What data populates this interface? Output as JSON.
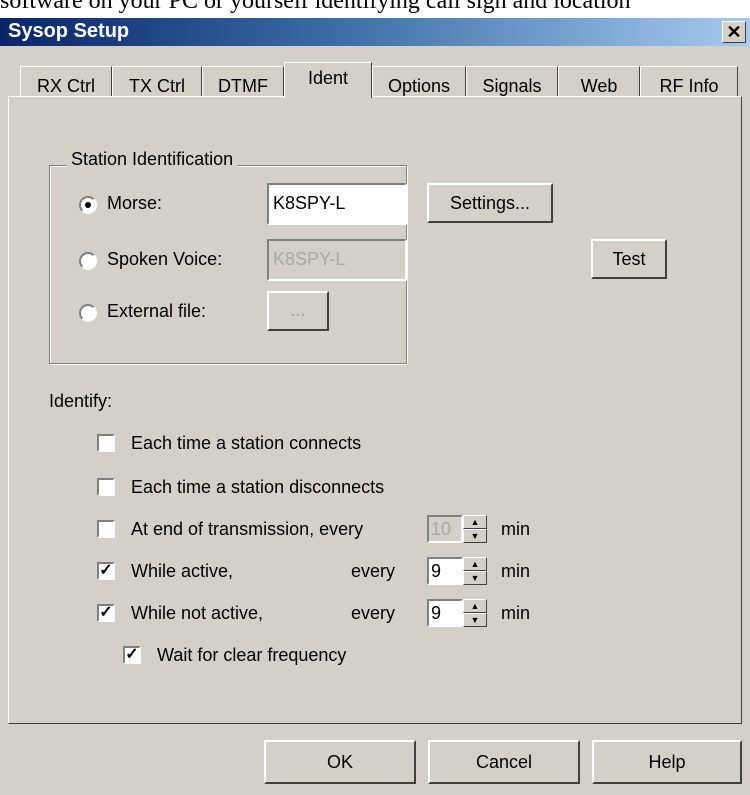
{
  "background_caption": "software on your PC or yourself identifying call sign and location",
  "window": {
    "title": "Sysop Setup",
    "close_glyph": "✕"
  },
  "tabs": [
    {
      "label": "RX Ctrl",
      "active": false
    },
    {
      "label": "TX Ctrl",
      "active": false
    },
    {
      "label": "DTMF",
      "active": false
    },
    {
      "label": "Ident",
      "active": true
    },
    {
      "label": "Options",
      "active": false
    },
    {
      "label": "Signals",
      "active": false
    },
    {
      "label": "Web",
      "active": false
    },
    {
      "label": "RF Info",
      "active": false
    }
  ],
  "station_id": {
    "group_label": "Station Identification",
    "morse": {
      "label": "Morse:",
      "value": "K8SPY-L",
      "selected": true
    },
    "spoken": {
      "label": "Spoken Voice:",
      "value": "K8SPY-L",
      "selected": false
    },
    "external": {
      "label": "External file:",
      "button": "...",
      "selected": false
    },
    "settings_button": "Settings...",
    "test_button": "Test"
  },
  "identify": {
    "heading": "Identify:",
    "connects": {
      "label": "Each time a station connects",
      "checked": false
    },
    "disconnects": {
      "label": "Each time a station disconnects",
      "checked": false
    },
    "end_tx": {
      "label": "At end of transmission, every",
      "value": "10",
      "unit": "min",
      "checked": false
    },
    "active": {
      "label": "While active,",
      "every": "every",
      "value": "9",
      "unit": "min",
      "checked": true
    },
    "not_active": {
      "label": "While not active,",
      "every": "every",
      "value": "9",
      "unit": "min",
      "checked": true
    },
    "wait_clear": {
      "label": "Wait for clear frequency",
      "checked": true
    }
  },
  "buttons": {
    "ok": "OK",
    "cancel": "Cancel",
    "help": "Help"
  },
  "glyphs": {
    "check": "✓",
    "up": "▲",
    "down": "▼"
  },
  "colors": {
    "titlebar_start": "#0a246a",
    "titlebar_end": "#a6caf0",
    "face": "#d4d0c8"
  }
}
